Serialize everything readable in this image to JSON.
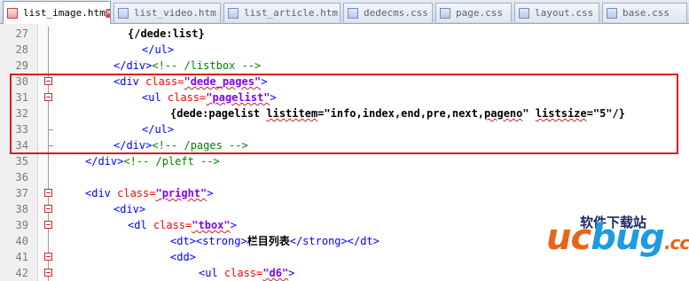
{
  "tabs": [
    {
      "label": "list_image.htm",
      "active": true
    },
    {
      "label": "list_video.htm",
      "active": false
    },
    {
      "label": "list_article.htm",
      "active": false
    },
    {
      "label": "dedecms.css",
      "active": false
    },
    {
      "label": "page.css",
      "active": false
    },
    {
      "label": "layout.css",
      "active": false
    },
    {
      "label": "base.css",
      "active": false
    }
  ],
  "lines": {
    "n27": "27",
    "n28": "28",
    "n29": "29",
    "n30": "30",
    "n31": "31",
    "n32": "32",
    "n33": "33",
    "n34": "34",
    "n35": "35",
    "n36": "36",
    "n37": "37",
    "n38": "38",
    "n39": "39",
    "n40": "40",
    "n41": "41",
    "n42": "42"
  },
  "code": {
    "l27": "{/dede:list}",
    "ul_close": "</ul>",
    "div_close": "</div>",
    "cmt_listbox": "<!-- /listbox -->",
    "div_open": "<div",
    "class_attr": " class=",
    "val_dede_pages": "\"dede_pages\"",
    "gt": ">",
    "ul_open": "<ul",
    "val_pagelist": "\"pagelist\"",
    "l32_a": "{dede:pagelist ",
    "l32_b": "listitem",
    "l32_c": "=\"info,index,end,pre,next,",
    "l32_d": "pageno",
    "l32_e": "\" ",
    "l32_f": "listsize",
    "l32_g": "=\"5\"/}",
    "cmt_pages": "<!-- /pages -->",
    "cmt_pleft": "<!-- /pleft -->",
    "val_pright": "\"pright\"",
    "dl_open": "<dl",
    "val_tbox": "\"tbox\"",
    "dt_strong": "<dt><strong>",
    "l40_text": "栏目列表",
    "strong_dt_close": "</strong></dt>",
    "dd_open": "<dd>",
    "val_d6": "\"d6\""
  },
  "watermark": {
    "logo_text": "ucbug.cc",
    "cn_text": "软件下载站"
  },
  "colors": {
    "tag": "#0000ff",
    "attr": "#ff0000",
    "value": "#8000ff",
    "comment": "#008000",
    "highlight": "#e01818"
  }
}
